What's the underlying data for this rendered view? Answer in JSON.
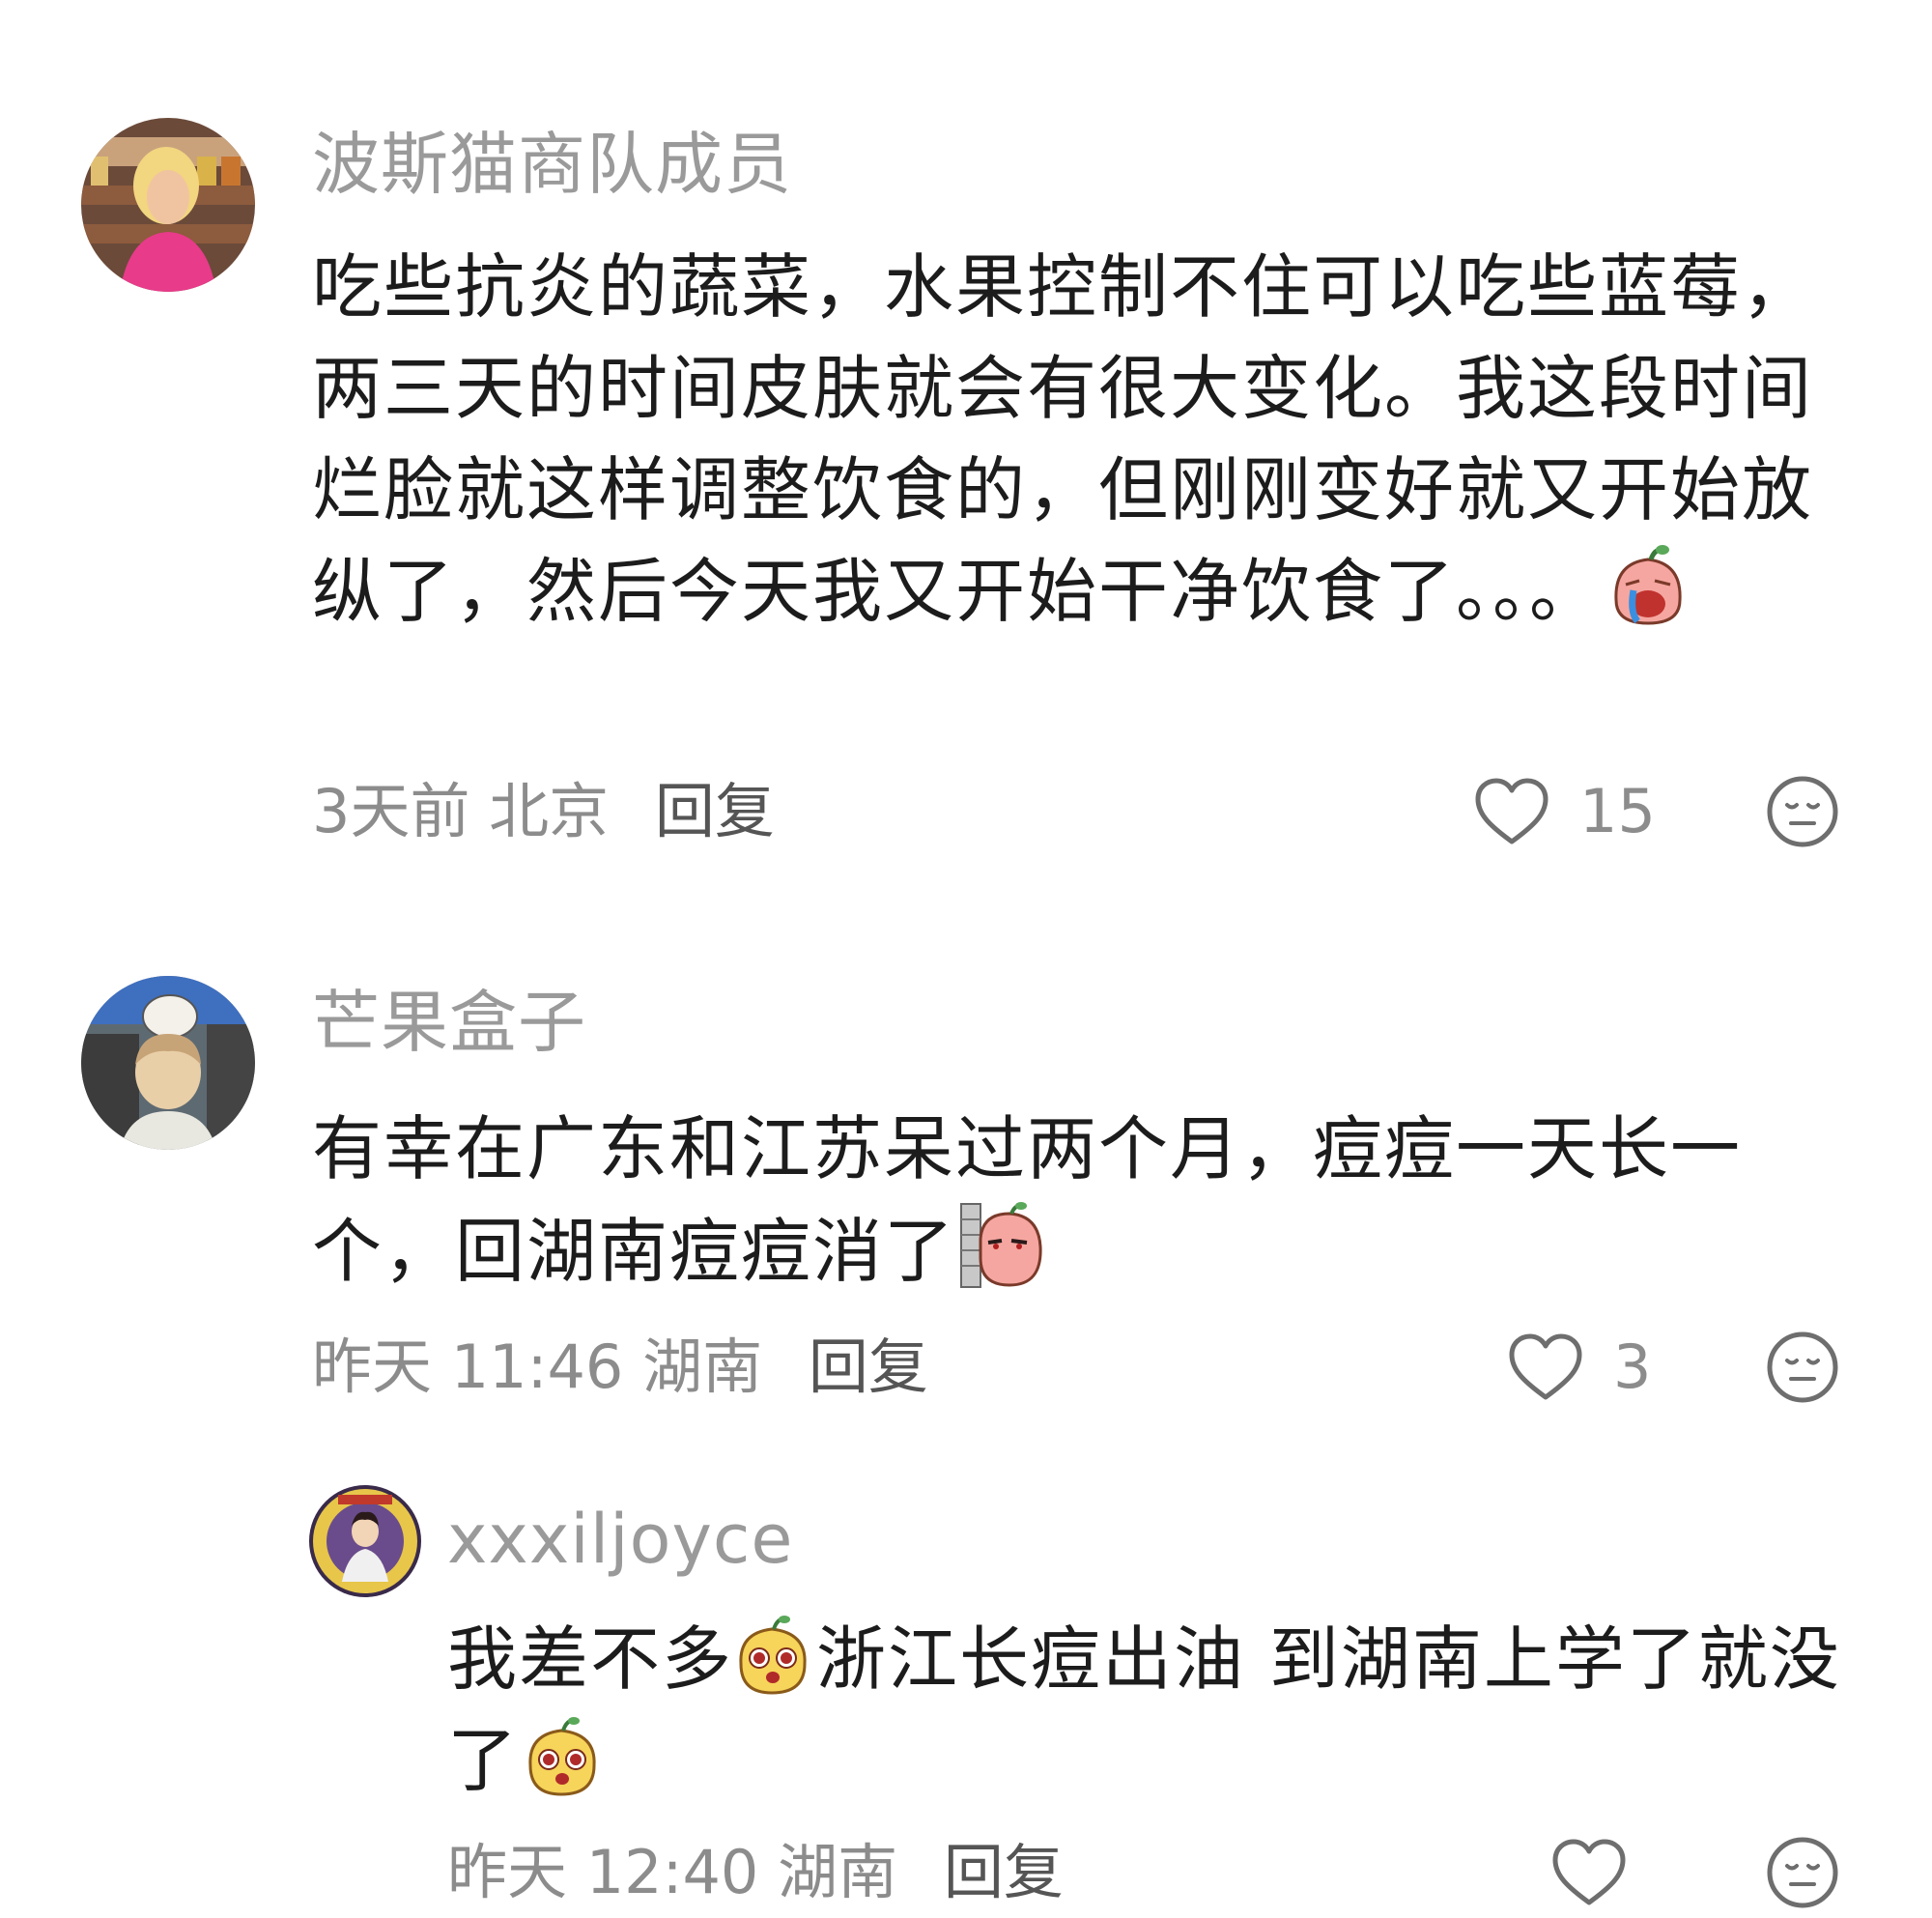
{
  "comments": [
    {
      "username": "波斯猫商队成员",
      "text": "吃些抗炎的蔬菜，水果控制不住可以吃些蓝莓，两三天的时间皮肤就会有很大变化。我这段时间烂脸就这样调整饮食的，但刚刚变好就又开始放纵了，然后今天我又开始干净饮食了。。。",
      "emoji": "crying-emoji",
      "time": "3天前",
      "location": "北京",
      "reply_label": "回复",
      "likes": "15"
    },
    {
      "username": "芒果盒子",
      "text": "有幸在广东和江苏呆过两个月，痘痘一天长一个，回湖南痘痘消了",
      "emoji": "peeking-wall-emoji",
      "time": "昨天 11:46",
      "location": "湖南",
      "reply_label": "回复",
      "likes": "3"
    },
    {
      "username": "xxxiljoyce",
      "text_part1": "我差不多",
      "text_part2": "浙江长痘出油 到湖南上学了就没了",
      "emoji": "pleading-face-emoji",
      "time": "昨天 12:40",
      "location": "湖南",
      "reply_label": "回复",
      "likes": ""
    }
  ],
  "colors": {
    "username": "#9a9a9a",
    "text": "#1c1c1c",
    "meta": "#8c8c8c",
    "icon": "#6e6e6e"
  }
}
